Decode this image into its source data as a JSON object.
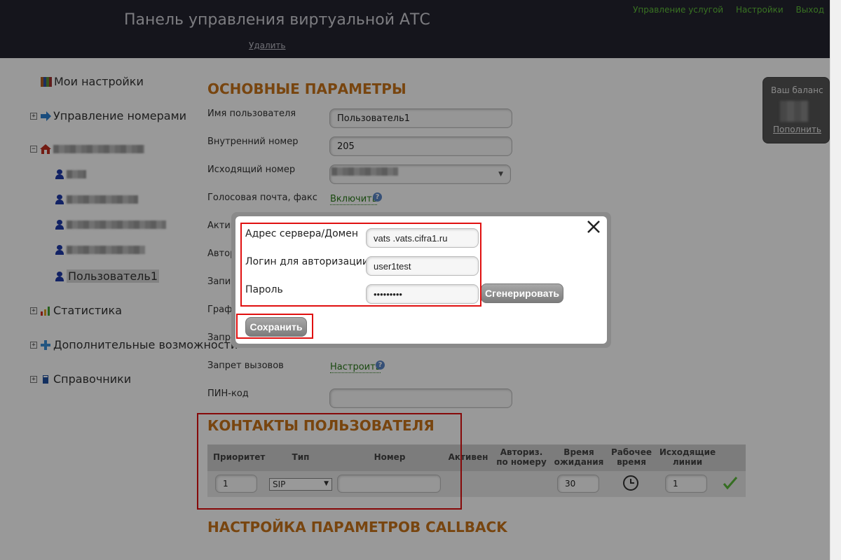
{
  "header": {
    "title": "Панель управления виртуальной АТС",
    "delete_link": "Удалить",
    "links": [
      "Управление услугой",
      "Настройки",
      "Выход"
    ]
  },
  "sidebar": {
    "my_settings": "Мои настройки",
    "numbers_management": "Управление номерами",
    "selected_user": "Пользователь1",
    "statistics": "Статистика",
    "extra_features": "Дополнительные возможности",
    "directories": "Справочники"
  },
  "balance": {
    "label": "Ваш баланс",
    "topup": "Пополнить"
  },
  "main_params": {
    "title": "ОСНОВНЫЕ ПАРАМЕТРЫ",
    "username_label": "Имя пользователя",
    "username_value": "Пользователь1",
    "internal_label": "Внутренний номер",
    "internal_value": "205",
    "outgoing_label": "Исходящий номер",
    "voicemail_label": "Голосовая почта, факс",
    "voicemail_link": "Включить",
    "active_label_partial": "Актив",
    "auth_label_partial": "Автор",
    "record_label_partial": "Запис",
    "schedule_label_partial": "Графи",
    "ban_label_partial": "Запре",
    "call_ban_label": "Запрет вызовов",
    "call_ban_link": "Настроить",
    "pin_label": "ПИН-код"
  },
  "contacts": {
    "title": "КОНТАКТЫ ПОЛЬЗОВАТЕЛЯ",
    "headers": [
      "Приоритет",
      "Тип",
      "Номер",
      "Активен",
      "Авториз. по номеру",
      "Время ожидания",
      "Рабочее время",
      "Исходящие линии"
    ],
    "row": {
      "priority": "1",
      "type": "SIP",
      "number": "",
      "wait_time": "30",
      "lines": "1"
    }
  },
  "callback": {
    "title": "НАСТРОЙКА ПАРАМЕТРОВ CALLBACK"
  },
  "modal": {
    "server_label": "Адрес сервера/Домен",
    "server_value": "vats       .vats.cifra1.ru",
    "login_label": "Логин для авторизации",
    "login_value": "user1test",
    "password_label": "Пароль",
    "password_value": "•••••••••",
    "generate_button": "Сгенерировать",
    "save_button": "Сохранить"
  },
  "colors": {
    "accent_orange": "#c8741a",
    "link_green": "#2a7a1a",
    "highlight_red": "#e01010",
    "header_bg": "#23232f"
  }
}
